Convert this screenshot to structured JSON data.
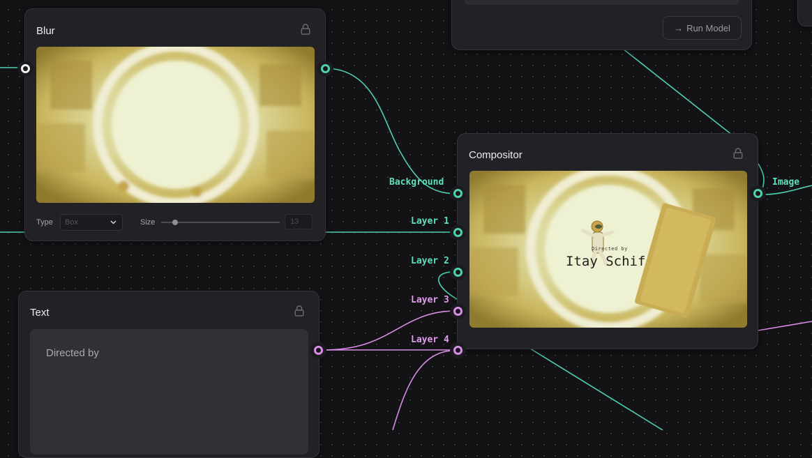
{
  "colors": {
    "canvas": "#131316",
    "node_bg": "#222226",
    "wire_green": "#4fd1b0",
    "wire_pink": "#d98ee6"
  },
  "blur_node": {
    "title": "Blur",
    "type_label": "Type",
    "type_value": "Box",
    "size_label": "Size",
    "size_value": "13",
    "size_slider_fraction": 0.12
  },
  "compositor_node": {
    "title": "Compositor",
    "inputs": [
      "Background",
      "Layer 1",
      "Layer 2",
      "Layer 3",
      "Layer 4"
    ],
    "output": "Image",
    "overlay_small": "Directed by",
    "overlay_large": "Itay Schif"
  },
  "text_node": {
    "title": "Text",
    "content": "Directed by"
  },
  "model_node": {
    "run_label": "Run Model",
    "run_icon": "arrow-right-icon"
  },
  "icons": {
    "lock": "lock-icon",
    "chevron": "chevron-down-icon"
  }
}
